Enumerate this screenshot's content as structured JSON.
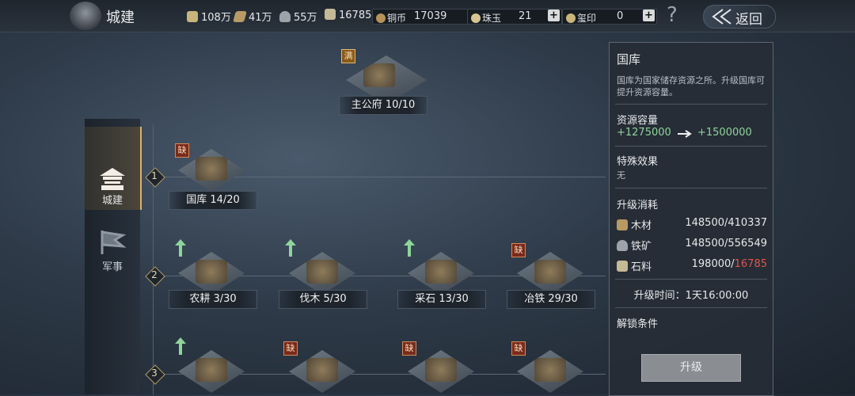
{
  "header": {
    "title": "城建",
    "resources": {
      "food": "108万",
      "wood": "41万",
      "iron": "55万",
      "stone": "16785"
    },
    "copper": {
      "label": "铜币",
      "value": "17039"
    },
    "jade": {
      "label": "珠玉",
      "value": "21"
    },
    "seal": {
      "label": "玺印",
      "value": "0"
    },
    "help": "?",
    "back_label": "返回"
  },
  "left_nav": {
    "items": [
      {
        "label": "城建",
        "selected": true,
        "icon": "palace-icon"
      },
      {
        "label": "军事",
        "selected": false,
        "icon": "flag-icon"
      }
    ]
  },
  "tree": {
    "top": {
      "label": "主公府 10/10",
      "tag": "满"
    },
    "rows": [
      {
        "num": "1",
        "buildings": [
          {
            "label": "国库 14/20",
            "tag": "缺",
            "upgradable": false
          }
        ]
      },
      {
        "num": "2",
        "buildings": [
          {
            "label": "农耕 3/30",
            "tag": "",
            "upgradable": true
          },
          {
            "label": "伐木 5/30",
            "tag": "",
            "upgradable": true
          },
          {
            "label": "采石 13/30",
            "tag": "",
            "upgradable": true
          },
          {
            "label": "冶铁 29/30",
            "tag": "缺",
            "upgradable": false
          }
        ]
      },
      {
        "num": "3",
        "buildings": [
          {
            "label": "",
            "tag": "",
            "upgradable": true
          },
          {
            "label": "",
            "tag": "缺",
            "upgradable": false
          },
          {
            "label": "",
            "tag": "缺",
            "upgradable": false
          },
          {
            "label": "",
            "tag": "缺",
            "upgradable": false
          }
        ]
      }
    ]
  },
  "panel": {
    "title": "国库",
    "description": "国库为国家储存资源之所。升级国库可提升资源容量。",
    "capacity_title": "资源容量",
    "capacity_from": "+1275000",
    "capacity_to": "+1500000",
    "effect_title": "特殊效果",
    "effect_value": "无",
    "cost_title": "升级消耗",
    "costs": [
      {
        "label": "木材",
        "value": "148500/410337",
        "enough": true
      },
      {
        "label": "铁矿",
        "value": "148500/556549",
        "enough": true
      },
      {
        "label": "石料",
        "value_need": "198000/",
        "value_have": "16785",
        "enough": false
      }
    ],
    "time_label": "升级时间：1天16:00:00",
    "unlock_title": "解锁条件",
    "upgrade_button": "升级"
  },
  "colors": {
    "accent_green": "#8fd49a",
    "warning_red": "#e2534a",
    "gold": "#d9b36a"
  }
}
